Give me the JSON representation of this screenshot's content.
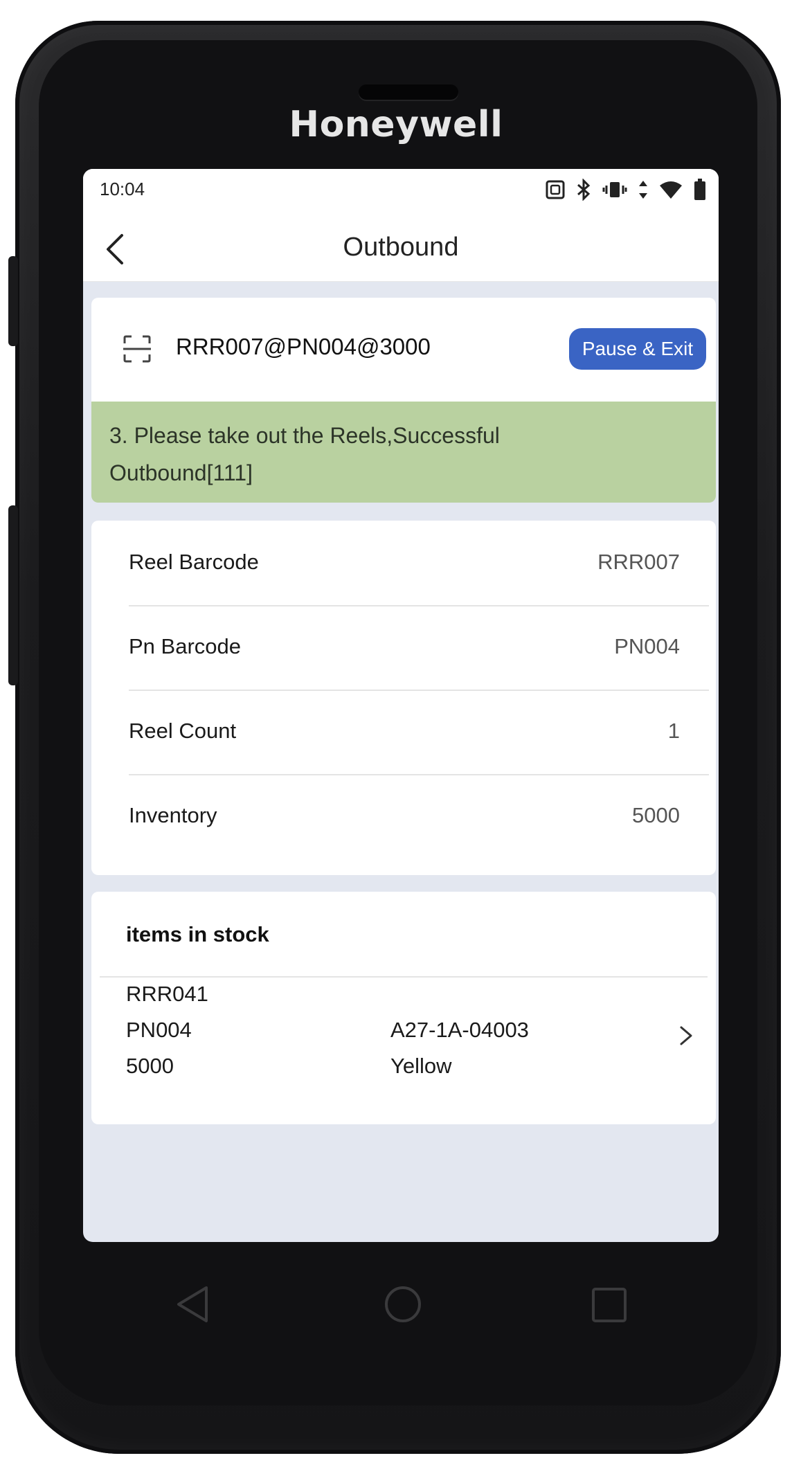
{
  "device": {
    "brand": "Honeywell"
  },
  "statusbar": {
    "time": "10:04",
    "icons": [
      "nfc-icon",
      "bluetooth-icon",
      "vibrate-icon",
      "data-arrows-icon",
      "wifi-icon",
      "battery-icon"
    ]
  },
  "appbar": {
    "title": "Outbound"
  },
  "scan": {
    "value": "RRR007@PN004@3000",
    "pause_label": "Pause & Exit",
    "accent": "#3a64c4"
  },
  "message": {
    "text": "3. Please take out the Reels,Successful Outbound[111]",
    "bg": "#b9d1a0"
  },
  "details": [
    {
      "label": "Reel Barcode",
      "value": "RRR007"
    },
    {
      "label": "Pn Barcode",
      "value": "PN004"
    },
    {
      "label": "Reel Count",
      "value": "1"
    },
    {
      "label": "Inventory",
      "value": "5000"
    }
  ],
  "stock": {
    "heading": "items in stock",
    "items": [
      {
        "reel": "RRR041",
        "pn": "PN004",
        "qty": "5000",
        "location": "A27-1A-04003",
        "color": "Yellow"
      }
    ]
  },
  "navkeys": [
    "back-key-icon",
    "home-key-icon",
    "recents-key-icon"
  ]
}
